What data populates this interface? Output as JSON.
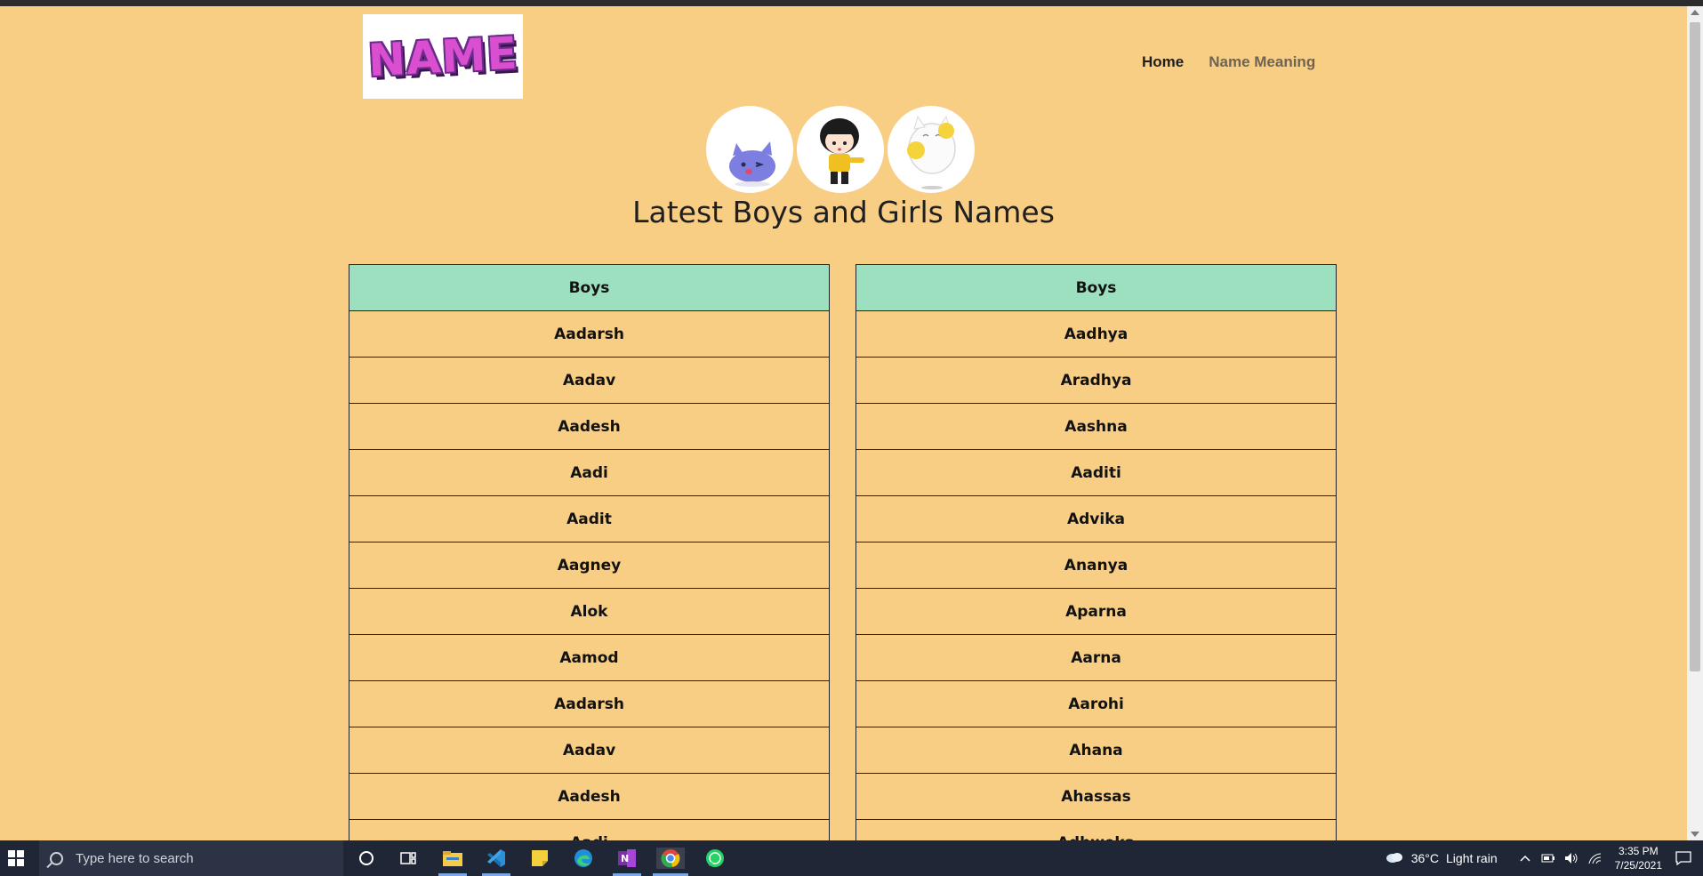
{
  "header": {
    "logo_text": "NAME",
    "nav": {
      "home": "Home",
      "name_meaning": "Name Meaning"
    }
  },
  "avatars": [
    "blue-cat-avatar",
    "girl-avatar",
    "white-cat-avatar"
  ],
  "page_title": "Latest Boys and Girls Names",
  "tables": {
    "left": {
      "header": "Boys",
      "names": [
        "Aadarsh",
        "Aadav",
        "Aadesh",
        "Aadi",
        "Aadit",
        "Aagney",
        "Alok",
        "Aamod",
        "Aadarsh",
        "Aadav",
        "Aadesh",
        "Aadi"
      ]
    },
    "right": {
      "header": "Boys",
      "names": [
        "Aadhya",
        "Aradhya",
        "Aashna",
        "Aaditi",
        "Advika",
        "Ananya",
        "Aparna",
        "Aarna",
        "Aarohi",
        "Ahana",
        "Ahassas",
        "Adhweka"
      ]
    }
  },
  "colors": {
    "page_background": "#f8cd84",
    "table_header": "#9ce0bf",
    "logo_fill": "#d94fd0",
    "taskbar": "#1f2636"
  },
  "taskbar": {
    "search_placeholder": "Type here to search",
    "apps": [
      "cortana-icon",
      "task-view-icon",
      "file-explorer-icon",
      "vscode-icon",
      "sticky-notes-icon",
      "edge-icon",
      "onenote-icon",
      "chrome-icon",
      "whatsapp-icon"
    ],
    "weather_temp": "36°C",
    "weather_text": "Light rain",
    "time": "3:35 PM",
    "date": "7/25/2021"
  }
}
